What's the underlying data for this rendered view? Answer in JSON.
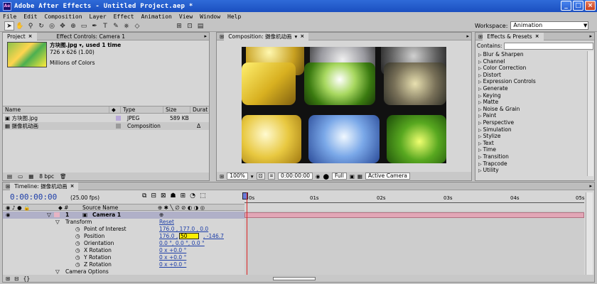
{
  "window": {
    "title": "Adobe After Effects - Untitled Project.aep *",
    "icon_text": "Ae"
  },
  "menu": [
    "File",
    "Edit",
    "Composition",
    "Layer",
    "Effect",
    "Animation",
    "View",
    "Window",
    "Help"
  ],
  "workspace": {
    "label": "Workspace:",
    "value": "Animation"
  },
  "project_panel": {
    "tabs": [
      "Project",
      "Effect Controls: Camera 1"
    ],
    "selected_item": {
      "name": "方块图.jpg ▾, used 1 time",
      "size": "726 x 626 (1.00)",
      "colors": "Millions of Colors"
    },
    "columns": [
      "Name",
      "Type",
      "Size",
      "Durat"
    ],
    "items": [
      {
        "name": "方块图.jpg",
        "type": "JPEG",
        "size": "589 KB",
        "dur": "",
        "color": "#b8a8d8"
      },
      {
        "name": "摄像机动画",
        "type": "Composition",
        "size": "",
        "dur": "Δ",
        "color": "#9a9a9a"
      }
    ],
    "footer_bpc": "8 bpc"
  },
  "comp_panel": {
    "tab": "Composition: 摄像机动画",
    "zoom": "100%",
    "time": "0:00:00:00",
    "resolution": "Full",
    "camera": "Active Camera"
  },
  "effects_panel": {
    "tab": "Effects & Presets",
    "contains_label": "Contains:",
    "items": [
      "Blur & Sharpen",
      "Channel",
      "Color Correction",
      "Distort",
      "Expression Controls",
      "Generate",
      "Keying",
      "Matte",
      "Noise & Grain",
      "Paint",
      "Perspective",
      "Simulation",
      "Stylize",
      "Text",
      "Time",
      "Transition",
      "Trapcode",
      "Utility"
    ]
  },
  "timeline": {
    "tab": "Timeline: 摄像机动画",
    "current_time": "0:00:00:00",
    "fps": "(25.00 fps)",
    "header_source": "Source Name",
    "ruler": [
      "0s",
      "01s",
      "02s",
      "03s",
      "04s",
      "05s"
    ],
    "layer": {
      "index": "1",
      "name": "Camera 1"
    },
    "transform_label": "Transform",
    "reset_label": "Reset",
    "properties": [
      {
        "name": "Point of Interest",
        "value": "176.0 , 177.0 , 0.0"
      },
      {
        "name": "Position",
        "value_a": "176.0 ,",
        "value_edit": "50",
        "value_b": ", -146.7"
      },
      {
        "name": "Orientation",
        "value": "0.0 °, 0.0 °, 0.0 °"
      },
      {
        "name": "X Rotation",
        "value": "0 x +0.0 °"
      },
      {
        "name": "Y Rotation",
        "value": "0 x +0.0 °"
      },
      {
        "name": "Z Rotation",
        "value": "0 x +0.0 °"
      }
    ],
    "camera_options_label": "Camera Options"
  },
  "colors": {
    "title_blue": "#1b4fc0",
    "time_blue": "#1c3da8",
    "track_pink": "#e2a6b6",
    "cti_red": "#dd2222"
  }
}
